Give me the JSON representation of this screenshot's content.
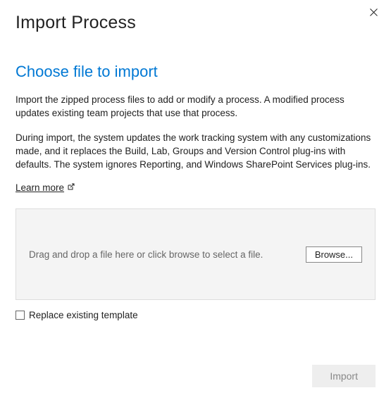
{
  "dialog": {
    "title": "Import Process"
  },
  "section": {
    "title": "Choose file to import",
    "description1": "Import the zipped process files to add or modify a process. A modified process updates existing team projects that use that process.",
    "description2": "During import, the system updates the work tracking system with any customizations made, and it replaces the Build, Lab, Groups and Version Control plug-ins with defaults. The system ignores Reporting, and Windows SharePoint Services plug-ins.",
    "learn_more_label": "Learn more"
  },
  "dropzone": {
    "placeholder": "Drag and drop a file here or click browse to select a file.",
    "browse_label": "Browse..."
  },
  "checkbox": {
    "label": "Replace existing template",
    "checked": false
  },
  "actions": {
    "import_label": "Import"
  }
}
